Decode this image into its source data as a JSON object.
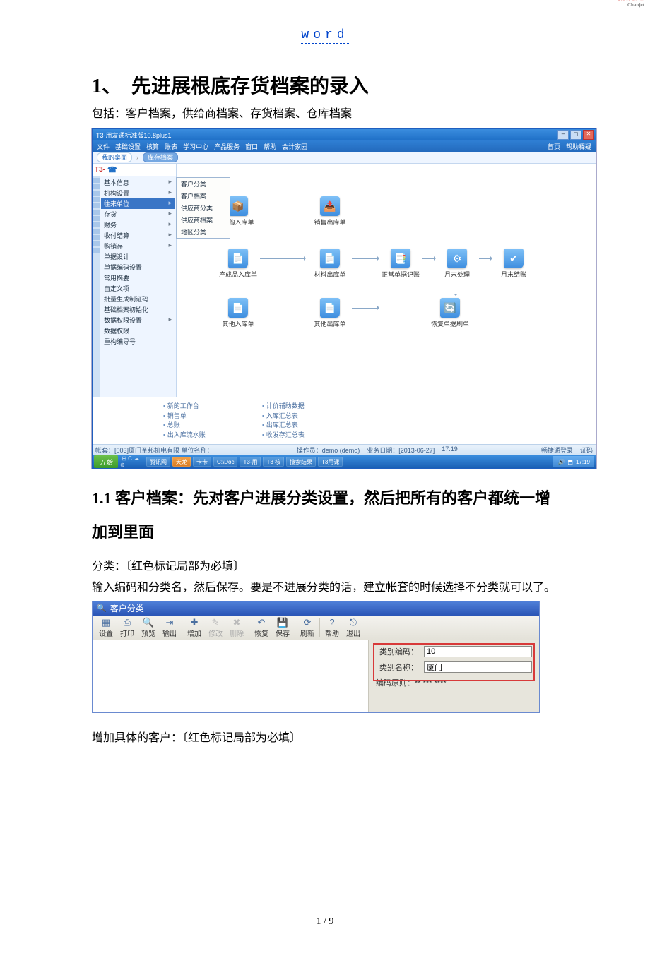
{
  "header_link": "word",
  "h1": "1、　先进展根底存货档案的录入",
  "subtitle": "包括：客户档案，供给商档案、存货档案、仓库档案",
  "h2": "1.1 客户档案：先对客户进展分类设置，然后把所有的客户都统一增加到里面",
  "p_classify": "分类：〔红色标记局部为必填〕",
  "p_input": "输入编码和分类名，然后保存。要是不进展分类的话，建立帐套的时候选择不分类就可以了。",
  "p_addcust": "增加具体的客户：〔红色标记局部为必填〕",
  "page_num": "1 / 9",
  "app": {
    "title": "T3-用友通标准版10.8plus1",
    "menu": [
      "文件",
      "基础设置",
      "核算",
      "账表",
      "学习中心",
      "产品服务",
      "窗口",
      "帮助",
      "会计家园"
    ],
    "menu_right": [
      "首页",
      "帮助释疑"
    ],
    "breadcrumb": {
      "home": "我的桌面",
      "current": "库存档案"
    },
    "logo_text": "T3-",
    "sidebar": [
      {
        "label": "基本信息",
        "arrow": true
      },
      {
        "label": "机构设置",
        "arrow": true
      },
      {
        "label": "往来单位",
        "arrow": true,
        "hl": true
      },
      {
        "label": "存货",
        "arrow": true
      },
      {
        "label": "财务",
        "arrow": true
      },
      {
        "label": "收付结算",
        "arrow": true
      },
      {
        "label": "购销存",
        "arrow": true
      },
      {
        "label": "单据设计",
        "arrow": false
      },
      {
        "label": "单据编码设置",
        "arrow": false
      },
      {
        "label": "常用摘要",
        "arrow": false
      },
      {
        "label": "自定义项",
        "arrow": false
      },
      {
        "label": "批量生成制证码",
        "arrow": false
      },
      {
        "label": "基础档案初始化",
        "arrow": false
      },
      {
        "label": "数据权限设置",
        "arrow": true
      },
      {
        "label": "数据权限",
        "arrow": false
      },
      {
        "label": "重构编导号",
        "arrow": false
      }
    ],
    "submenu": [
      "客户分类",
      "客户档案",
      "供应商分类",
      "供应商档案",
      "地区分类"
    ],
    "flow": {
      "n1": "采购入库单",
      "n2": "销售出库单",
      "n3": "产成品入库单",
      "n4": "材料出库单",
      "n5": "正常单据记账",
      "n6": "月末处理",
      "n7": "月末结账",
      "n8": "其他入库单",
      "n9": "其他出库单",
      "n10": "恢复单据刷单"
    },
    "links": {
      "l1": "新的工作台",
      "r1": "计价辅助数据",
      "l2": "销售单",
      "r2": "入库汇总表",
      "l3": "总账",
      "r3": "出库汇总表",
      "l4": "出入库流水账",
      "r4": "收发存汇总表"
    },
    "brand": "畅捷通",
    "brand_sub": "Chanjet",
    "status": {
      "left": "帐套：[003]厦门圣邦机电有限 单位名称：",
      "op": "操作员：demo (demo)",
      "date": "业务日期：[2013-06-27]",
      "time": "17:19",
      "login": "畅捷通登录",
      "code": "证码"
    },
    "taskbar": {
      "start": "开始",
      "items": [
        "腾讯网",
        "天龙",
        "卡卡",
        "C:\\Doc",
        "T3-用",
        "T3 核",
        "搜索结果",
        "T3用课"
      ],
      "tray_time": "17:19"
    }
  },
  "dlg": {
    "title": "客户分类",
    "tools": [
      {
        "k": "settings",
        "ic": "▦",
        "label": "设置",
        "en": true
      },
      {
        "k": "print",
        "ic": "⎙",
        "label": "打印",
        "en": true
      },
      {
        "k": "preview",
        "ic": "🔍",
        "label": "预览",
        "en": true
      },
      {
        "k": "output",
        "ic": "⇥",
        "label": "输出",
        "en": true
      },
      {
        "k": "sep"
      },
      {
        "k": "add",
        "ic": "✚",
        "label": "增加",
        "en": true
      },
      {
        "k": "edit",
        "ic": "✎",
        "label": "修改",
        "en": false
      },
      {
        "k": "delete",
        "ic": "✖",
        "label": "删除",
        "en": false
      },
      {
        "k": "sep"
      },
      {
        "k": "undo",
        "ic": "↶",
        "label": "恢复",
        "en": true
      },
      {
        "k": "save",
        "ic": "💾",
        "label": "保存",
        "en": true
      },
      {
        "k": "sep"
      },
      {
        "k": "refresh",
        "ic": "⟳",
        "label": "刷新",
        "en": true
      },
      {
        "k": "sep"
      },
      {
        "k": "help",
        "ic": "?",
        "label": "帮助",
        "en": true
      },
      {
        "k": "exit",
        "ic": "⎋",
        "label": "退出",
        "en": true
      }
    ],
    "code_label": "类别编码：",
    "code_value": "10",
    "name_label": "类别名称：",
    "name_value": "厦门",
    "rule": "编码原则：** *** ****"
  }
}
